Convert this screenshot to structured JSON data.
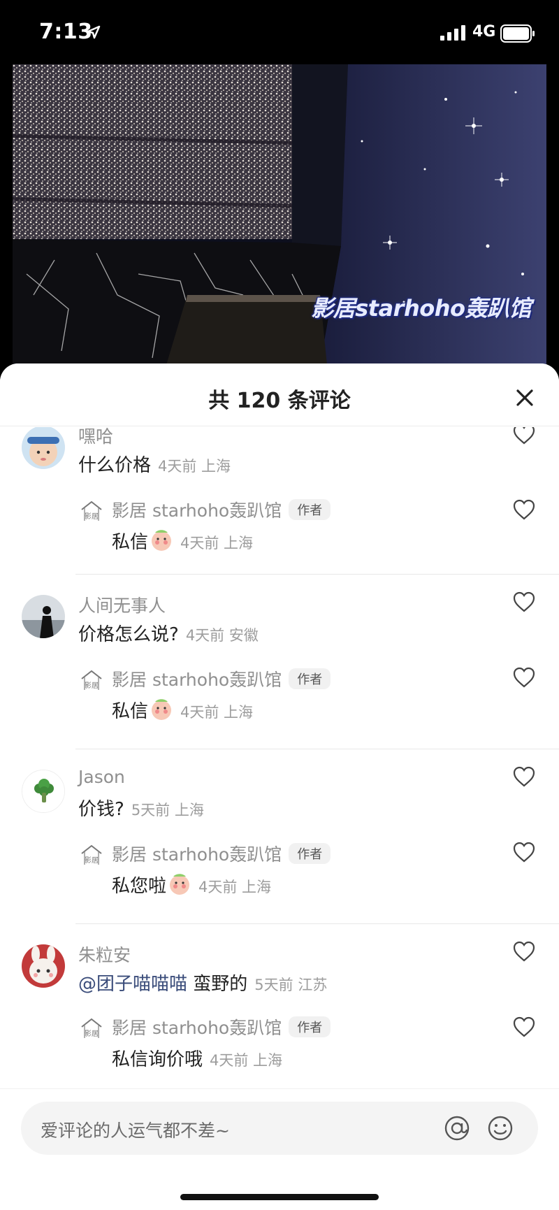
{
  "status_bar": {
    "time": "7:13",
    "network": "4G"
  },
  "video": {
    "watermark": "影居starhoho轰趴馆"
  },
  "sheet": {
    "title": "共 120 条评论"
  },
  "threads": [
    {
      "name": "嘿哈",
      "text": "什么价格",
      "meta": "4天前 上海",
      "reply": {
        "name": "影居 starhoho轰趴馆",
        "tag": "作者",
        "text": "私信",
        "meta": "4天前 上海"
      }
    },
    {
      "name": "人间无事人",
      "text": "价格怎么说?",
      "meta": "4天前 安徽",
      "reply": {
        "name": "影居 starhoho轰趴馆",
        "tag": "作者",
        "text": "私信",
        "meta": "4天前 上海"
      }
    },
    {
      "name": "Jason",
      "text": "价钱?",
      "meta": "5天前 上海",
      "reply": {
        "name": "影居 starhoho轰趴馆",
        "tag": "作者",
        "text": "私您啦",
        "meta": "4天前 上海"
      }
    },
    {
      "name": "朱粒安",
      "mention": "@团子喵喵喵",
      "text": " 蛮野的",
      "meta": "5天前 江苏",
      "reply": {
        "name": "影居 starhoho轰趴馆",
        "tag": "作者",
        "text": "私信询价哦",
        "meta": "4天前 上海"
      }
    }
  ],
  "input": {
    "placeholder": "爱评论的人运气都不差~"
  },
  "icons": {
    "close": "close-icon",
    "like": "heart-icon",
    "at": "at-sign-icon",
    "emoji": "smiley-icon",
    "logo": "house-logo-icon"
  },
  "colors": {
    "mention": "#3a4c7a",
    "meta": "#9d9d9d",
    "name": "#8f8f8f"
  }
}
